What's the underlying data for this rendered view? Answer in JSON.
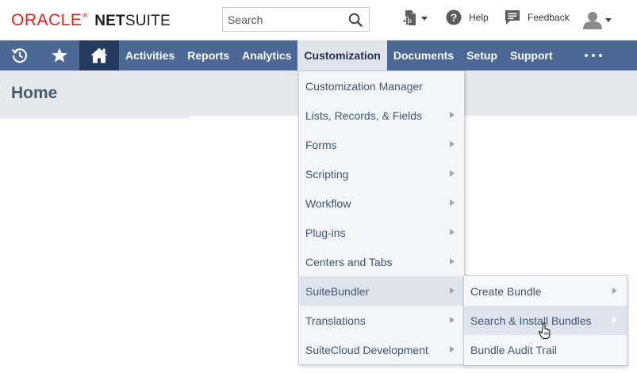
{
  "header": {
    "logo": {
      "oracle": "ORACLE",
      "registered": "®",
      "netsuite_bold": "NET",
      "netsuite_rest": "SUITE"
    },
    "search": {
      "placeholder": "Search",
      "icon": "search-icon"
    },
    "new_record_icon": "new-record-icon",
    "help_label": "Help",
    "feedback_label": "Feedback",
    "user_icon": "user-avatar-icon"
  },
  "navbar": {
    "icons": [
      "recent-records-icon",
      "star-icon",
      "home-icon"
    ],
    "items": [
      {
        "label": "Activities",
        "active": false
      },
      {
        "label": "Reports",
        "active": false
      },
      {
        "label": "Analytics",
        "active": false
      },
      {
        "label": "Customization",
        "active": true
      },
      {
        "label": "Documents",
        "active": false
      },
      {
        "label": "Setup",
        "active": false
      },
      {
        "label": "Support",
        "active": false
      }
    ],
    "more_icon": "more-dots-icon"
  },
  "page": {
    "title": "Home"
  },
  "customization_menu": {
    "items": [
      {
        "label": "Customization Manager",
        "submenu": false
      },
      {
        "label": "Lists, Records, & Fields",
        "submenu": true
      },
      {
        "label": "Forms",
        "submenu": true
      },
      {
        "label": "Scripting",
        "submenu": true
      },
      {
        "label": "Workflow",
        "submenu": true
      },
      {
        "label": "Plug-ins",
        "submenu": true
      },
      {
        "label": "Centers and Tabs",
        "submenu": true
      },
      {
        "label": "SuiteBundler",
        "submenu": true,
        "highlighted": true
      },
      {
        "label": "Translations",
        "submenu": true
      },
      {
        "label": "SuiteCloud Development",
        "submenu": true
      }
    ]
  },
  "suitebundler_submenu": {
    "items": [
      {
        "label": "Create Bundle",
        "submenu": true
      },
      {
        "label": "Search & Install Bundles",
        "submenu": true,
        "highlighted": true
      },
      {
        "label": "Bundle Audit Trail",
        "submenu": false
      }
    ]
  },
  "colors": {
    "navbar_bg": "#4c6894",
    "home_tab_bg": "#243a5e",
    "active_tab_bg": "#dfe4eb",
    "oracle_red": "#e3241b",
    "menu_text": "#3f5575",
    "menu_highlight": "#dfe4ec"
  }
}
